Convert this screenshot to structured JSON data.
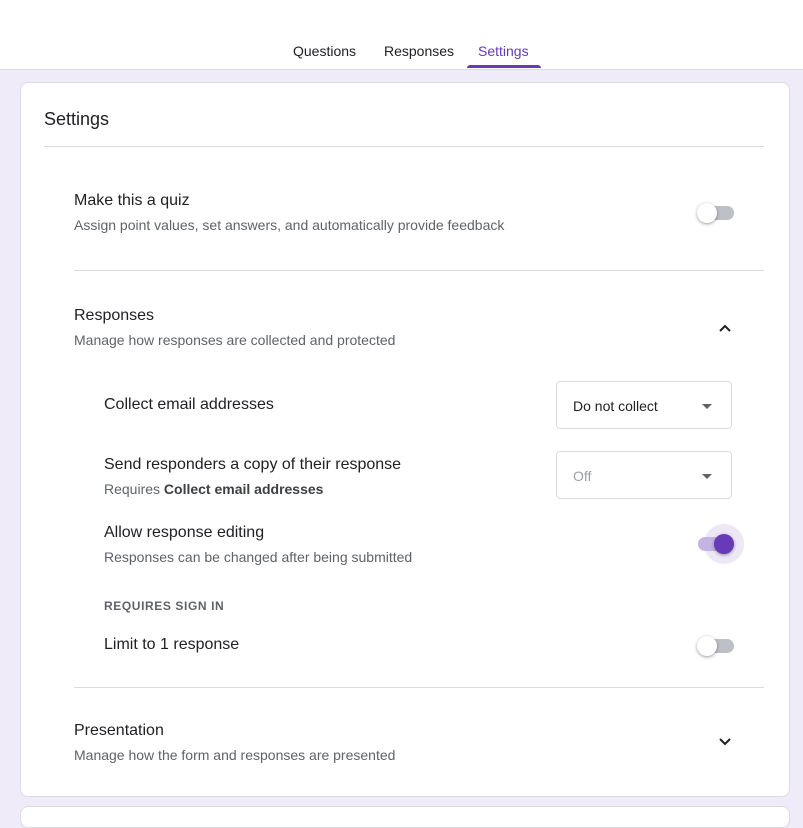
{
  "tabs": [
    {
      "label": "Questions"
    },
    {
      "label": "Responses"
    },
    {
      "label": "Settings"
    }
  ],
  "settings": {
    "title": "Settings",
    "quiz": {
      "title": "Make this a quiz",
      "desc": "Assign point values, set answers, and automatically provide feedback",
      "enabled": false
    },
    "responses": {
      "title": "Responses",
      "desc": "Manage how responses are collected and protected",
      "expanded": true,
      "collect_email": {
        "label": "Collect email addresses",
        "value": "Do not collect"
      },
      "send_copy": {
        "label": "Send responders a copy of their response",
        "desc_prefix": "Requires",
        "desc_bold": "Collect email addresses",
        "value": "Off"
      },
      "allow_editing": {
        "label": "Allow response editing",
        "desc": "Responses can be changed after being submitted",
        "enabled": true
      },
      "requires_sign_in": "REQUIRES SIGN IN",
      "limit_one": {
        "label": "Limit to 1 response",
        "enabled": false
      }
    },
    "presentation": {
      "title": "Presentation",
      "desc": "Manage how the form and responses are presented",
      "expanded": false
    }
  },
  "colors": {
    "accent": "#673ab7",
    "background": "#f0ebf8"
  }
}
